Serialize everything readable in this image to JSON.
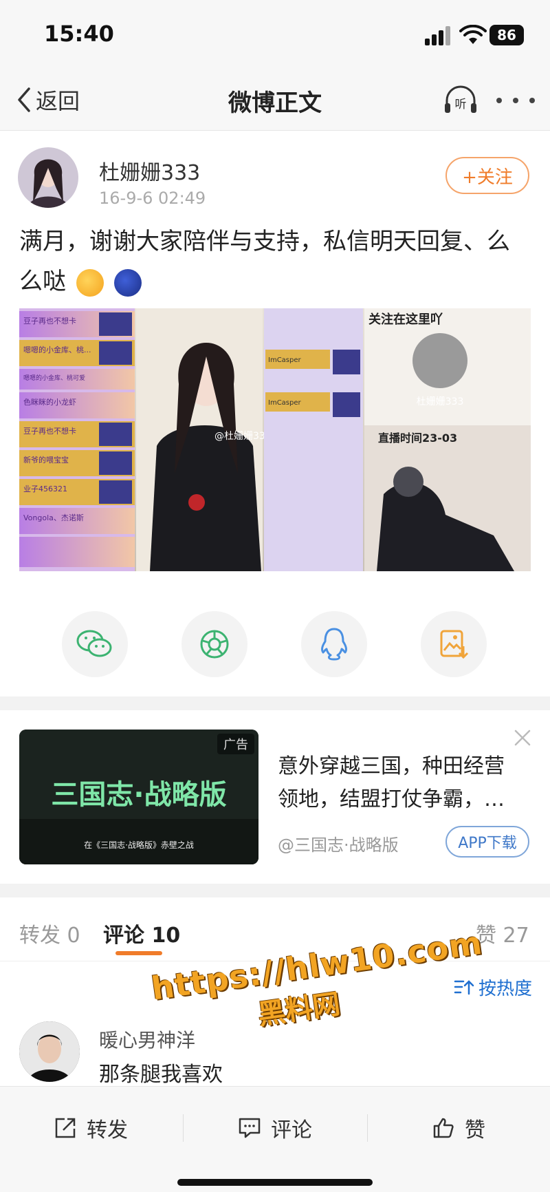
{
  "status_bar": {
    "time": "15:40",
    "battery": "86"
  },
  "nav": {
    "back_label": "返回",
    "title": "微博正文",
    "listen_label": "听"
  },
  "post": {
    "username": "杜姗姗333",
    "time": "16-9-6 02:49",
    "follow_label": "+关注",
    "text": "满月，谢谢大家陪伴与支持，私信明天回复、么么哒"
  },
  "image_overlay": {
    "follow_here": "关注在这里吖",
    "live_time": "直播时间23-03",
    "handle": "@杜姗姗333",
    "name_tag": "杜姗姗333",
    "chat_left": [
      "豆子再也不想卡",
      "嗯嗯的小金库、桃...",
      "嗯嗯的小金库、桃可爱",
      "色眯眯的小龙虾",
      "豆子再也不想卡",
      "新爷的喂宝宝",
      "业子456321",
      "Vongola、杰诺斯"
    ],
    "chat_right": [
      "ImCasper",
      "ImCasper"
    ]
  },
  "share_icons": [
    "wechat-icon",
    "moments-icon",
    "qq-icon",
    "save-image-icon"
  ],
  "ad": {
    "badge": "广告",
    "game_title": "三国志·战略版",
    "subtitle": "在《三国志·战略版》赤壁之战",
    "title": "意外穿越三国，种田经营领地，结盟打仗争霸，…",
    "source": "@三国志·战略版",
    "button": "APP下载"
  },
  "tabs": {
    "repost": "转发 0",
    "comment": "评论 10",
    "like": "赞 27"
  },
  "sort_label": "按热度",
  "comment": {
    "user": "暖心男神洋",
    "text": "那条腿我喜欢"
  },
  "watermark": {
    "url": "https://hlw10.com",
    "name": "黑料网"
  },
  "bottom_bar": {
    "repost": "转发",
    "comment": "评论",
    "like": "赞"
  },
  "colors": {
    "accent": "#f07c2a",
    "link": "#1f6fd0"
  }
}
